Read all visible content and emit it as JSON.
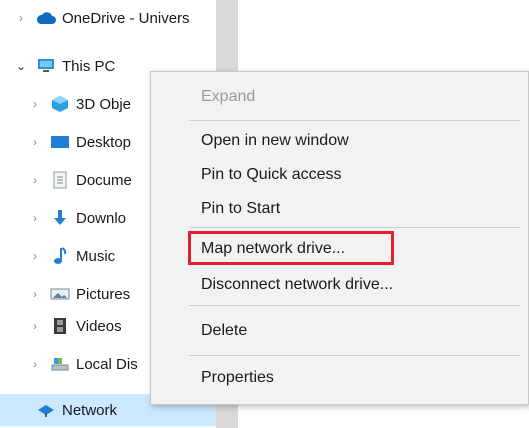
{
  "nav": {
    "items": [
      {
        "label": "OneDrive - Univers",
        "icon": "cloud-icon",
        "expanded": false
      },
      {
        "label": "This PC",
        "icon": "computer-icon",
        "expanded": true
      },
      {
        "label": "3D Obje",
        "icon": "cube-icon",
        "expanded": false
      },
      {
        "label": "Desktop",
        "icon": "desktop-icon",
        "expanded": false
      },
      {
        "label": "Docume",
        "icon": "document-icon",
        "expanded": false
      },
      {
        "label": "Downlo",
        "icon": "download-arrow-icon",
        "expanded": false
      },
      {
        "label": "Music",
        "icon": "music-note-icon",
        "expanded": false
      },
      {
        "label": "Pictures",
        "icon": "pictures-icon",
        "expanded": false
      },
      {
        "label": "Videos",
        "icon": "film-icon",
        "expanded": false
      },
      {
        "label": "Local Dis",
        "icon": "drive-icon",
        "expanded": false
      },
      {
        "label": "Network",
        "icon": "network-icon",
        "selected": true
      }
    ]
  },
  "context_menu": {
    "items": [
      {
        "label": "Expand",
        "disabled": true
      },
      {
        "label": "Open in new window"
      },
      {
        "label": "Pin to Quick access"
      },
      {
        "label": "Pin to Start"
      },
      {
        "label": "Map network drive...",
        "highlighted": true
      },
      {
        "label": "Disconnect network drive..."
      },
      {
        "label": "Delete"
      },
      {
        "label": "Properties"
      }
    ]
  },
  "colors": {
    "selection": "#cce8ff",
    "highlight_border": "#e0202a",
    "menu_background": "#f2f2f2"
  }
}
